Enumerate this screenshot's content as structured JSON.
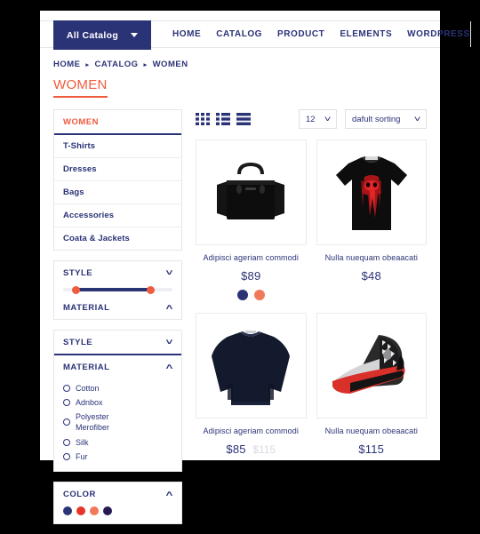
{
  "theme": {
    "navy": "#2b3377",
    "orange": "#ef5b3e",
    "red": "#e8342a",
    "salmon": "#f0795a",
    "dark_navy": "#231a52",
    "muted": "#d8d8e2",
    "page_bg": "#000000",
    "card_bg": "#ffffff"
  },
  "navbar": {
    "catalog_button": "All Catalog",
    "links": [
      {
        "label": "HOME"
      },
      {
        "label": "CATALOG"
      },
      {
        "label": "PRODUCT"
      },
      {
        "label": "ELEMENTS"
      },
      {
        "label": "WORDPRESS"
      }
    ],
    "search_icon": "search-icon"
  },
  "breadcrumb": {
    "items": [
      "HOME",
      "CATALOG",
      "WOMEN"
    ],
    "separator": "▸"
  },
  "page_title": "WOMEN",
  "sidebar": {
    "categories_widget": {
      "heading": "WOMEN",
      "items": [
        {
          "label": "T-Shirts"
        },
        {
          "label": "Dresses"
        },
        {
          "label": "Bags"
        },
        {
          "label": "Accessories"
        },
        {
          "label": "Coata & Jackets"
        }
      ]
    },
    "price_widget": {
      "style_heading": "STYLE",
      "style_chevron": "chevron-down-icon",
      "material_heading": "MATERIAL",
      "material_chevron": "chevron-up-icon"
    },
    "material_widget": {
      "style_heading": "STYLE",
      "style_chevron": "chevron-down-icon",
      "material_heading": "MATERIAL",
      "material_chevron": "chevron-up-icon",
      "options": [
        {
          "label": "Cotton"
        },
        {
          "label": "Adnbox"
        },
        {
          "label": "Polyester\nMerofiber"
        },
        {
          "label": "Silk"
        },
        {
          "label": "Fur"
        }
      ]
    },
    "color_widget": {
      "heading": "COLOR",
      "chevron": "chevron-up-icon",
      "swatches": [
        "#2b3377",
        "#e8342a",
        "#f0795a",
        "#231a52"
      ]
    }
  },
  "toolbar": {
    "view_modes": [
      {
        "name": "grid-view-icon"
      },
      {
        "name": "list-view-icon"
      },
      {
        "name": "row-view-icon"
      }
    ],
    "per_page": {
      "value": "12",
      "chevron": "chevron-down-icon"
    },
    "sorting": {
      "value": "dafult sorting",
      "chevron": "chevron-down-icon"
    }
  },
  "products": [
    {
      "image": "handbag",
      "title": "Adipisci ageriam commodi",
      "price": "$89",
      "old_price": "",
      "colors": [
        "#2b3377",
        "#f0795a"
      ]
    },
    {
      "image": "tshirt",
      "title": "Nulla nuequam obeaacati",
      "price": "$48",
      "old_price": "",
      "colors": []
    },
    {
      "image": "sweater",
      "title": "Adipisci ageriam commodi",
      "price": "$85",
      "old_price": "$115",
      "colors": []
    },
    {
      "image": "sneaker",
      "title": "Nulla nuequam obeaacati",
      "price": "$115",
      "old_price": "",
      "colors": []
    }
  ]
}
